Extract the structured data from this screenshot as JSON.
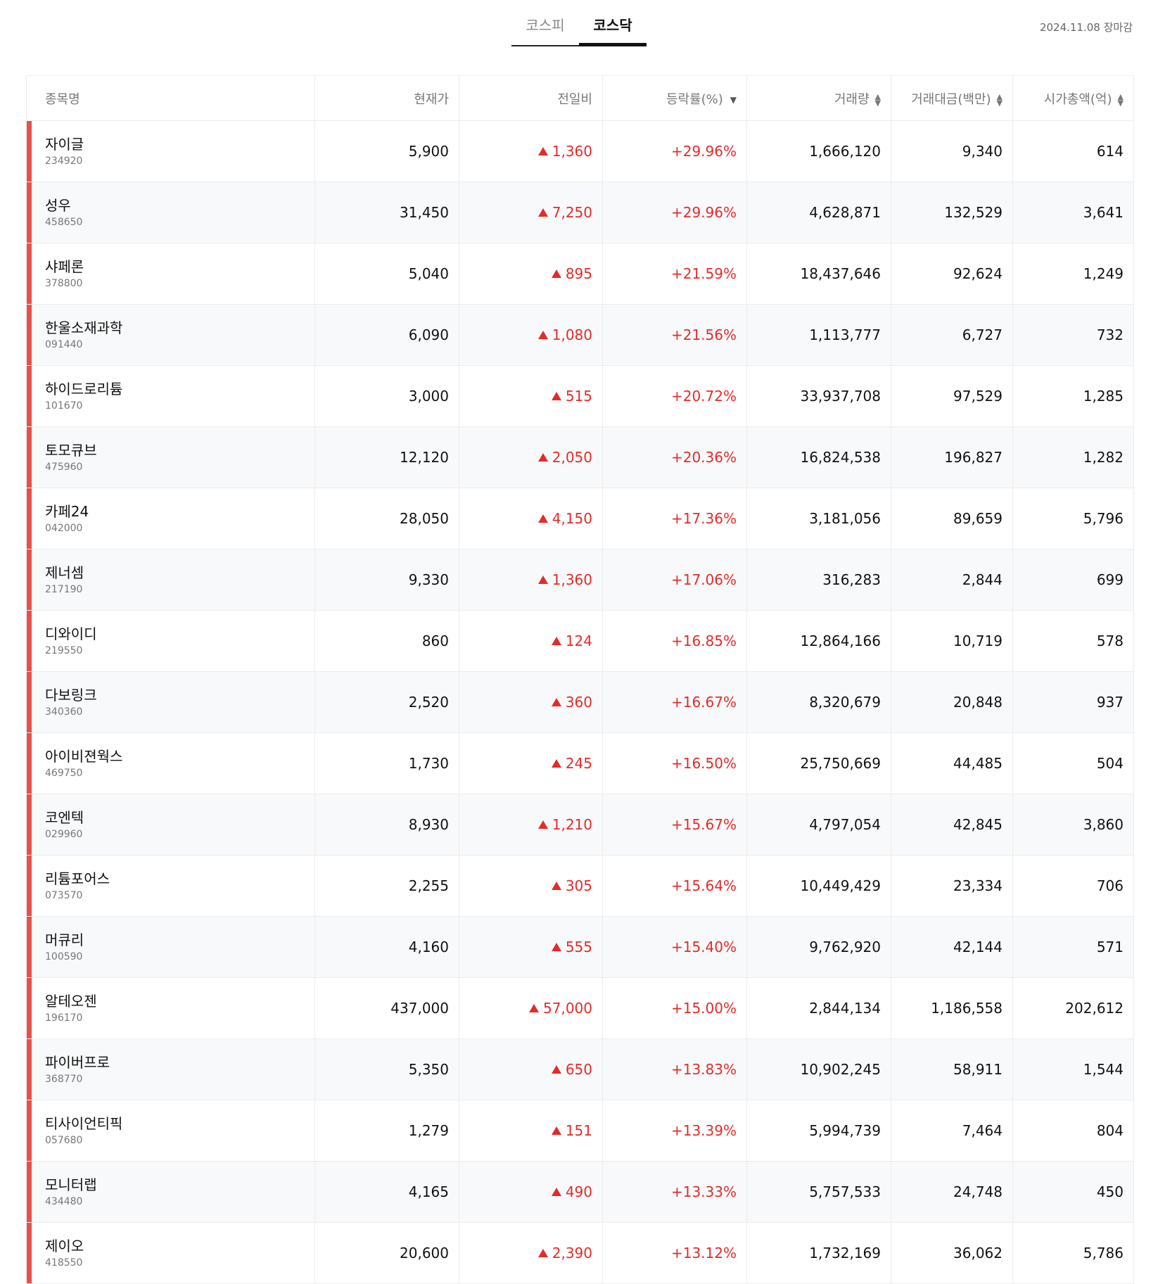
{
  "tabs": [
    {
      "label": "코스피",
      "active": false
    },
    {
      "label": "코스닥",
      "active": true
    }
  ],
  "date_label": "2024.11.08 장마감",
  "colors": {
    "up": "#e22c29",
    "row_bar": "#e8504a"
  },
  "columns": {
    "name": "종목명",
    "price": "현재가",
    "diff": "전일비",
    "rate": "등락률(%)",
    "volume": "거래량",
    "amount": "거래대금(백만)",
    "marketcap": "시가총액(억)"
  },
  "rows": [
    {
      "name": "자이글",
      "code": "234920",
      "price": "5,900",
      "diff": "1,360",
      "rate": "+29.96%",
      "volume": "1,666,120",
      "amount": "9,340",
      "marketcap": "614"
    },
    {
      "name": "성우",
      "code": "458650",
      "price": "31,450",
      "diff": "7,250",
      "rate": "+29.96%",
      "volume": "4,628,871",
      "amount": "132,529",
      "marketcap": "3,641"
    },
    {
      "name": "샤페론",
      "code": "378800",
      "price": "5,040",
      "diff": "895",
      "rate": "+21.59%",
      "volume": "18,437,646",
      "amount": "92,624",
      "marketcap": "1,249"
    },
    {
      "name": "한울소재과학",
      "code": "091440",
      "price": "6,090",
      "diff": "1,080",
      "rate": "+21.56%",
      "volume": "1,113,777",
      "amount": "6,727",
      "marketcap": "732"
    },
    {
      "name": "하이드로리튬",
      "code": "101670",
      "price": "3,000",
      "diff": "515",
      "rate": "+20.72%",
      "volume": "33,937,708",
      "amount": "97,529",
      "marketcap": "1,285"
    },
    {
      "name": "토모큐브",
      "code": "475960",
      "price": "12,120",
      "diff": "2,050",
      "rate": "+20.36%",
      "volume": "16,824,538",
      "amount": "196,827",
      "marketcap": "1,282"
    },
    {
      "name": "카페24",
      "code": "042000",
      "price": "28,050",
      "diff": "4,150",
      "rate": "+17.36%",
      "volume": "3,181,056",
      "amount": "89,659",
      "marketcap": "5,796"
    },
    {
      "name": "제너셈",
      "code": "217190",
      "price": "9,330",
      "diff": "1,360",
      "rate": "+17.06%",
      "volume": "316,283",
      "amount": "2,844",
      "marketcap": "699"
    },
    {
      "name": "디와이디",
      "code": "219550",
      "price": "860",
      "diff": "124",
      "rate": "+16.85%",
      "volume": "12,864,166",
      "amount": "10,719",
      "marketcap": "578"
    },
    {
      "name": "다보링크",
      "code": "340360",
      "price": "2,520",
      "diff": "360",
      "rate": "+16.67%",
      "volume": "8,320,679",
      "amount": "20,848",
      "marketcap": "937"
    },
    {
      "name": "아이비젼웍스",
      "code": "469750",
      "price": "1,730",
      "diff": "245",
      "rate": "+16.50%",
      "volume": "25,750,669",
      "amount": "44,485",
      "marketcap": "504"
    },
    {
      "name": "코엔텍",
      "code": "029960",
      "price": "8,930",
      "diff": "1,210",
      "rate": "+15.67%",
      "volume": "4,797,054",
      "amount": "42,845",
      "marketcap": "3,860"
    },
    {
      "name": "리튬포어스",
      "code": "073570",
      "price": "2,255",
      "diff": "305",
      "rate": "+15.64%",
      "volume": "10,449,429",
      "amount": "23,334",
      "marketcap": "706"
    },
    {
      "name": "머큐리",
      "code": "100590",
      "price": "4,160",
      "diff": "555",
      "rate": "+15.40%",
      "volume": "9,762,920",
      "amount": "42,144",
      "marketcap": "571"
    },
    {
      "name": "알테오젠",
      "code": "196170",
      "price": "437,000",
      "diff": "57,000",
      "rate": "+15.00%",
      "volume": "2,844,134",
      "amount": "1,186,558",
      "marketcap": "202,612"
    },
    {
      "name": "파이버프로",
      "code": "368770",
      "price": "5,350",
      "diff": "650",
      "rate": "+13.83%",
      "volume": "10,902,245",
      "amount": "58,911",
      "marketcap": "1,544"
    },
    {
      "name": "티사이언티픽",
      "code": "057680",
      "price": "1,279",
      "diff": "151",
      "rate": "+13.39%",
      "volume": "5,994,739",
      "amount": "7,464",
      "marketcap": "804"
    },
    {
      "name": "모니터랩",
      "code": "434480",
      "price": "4,165",
      "diff": "490",
      "rate": "+13.33%",
      "volume": "5,757,533",
      "amount": "24,748",
      "marketcap": "450"
    },
    {
      "name": "제이오",
      "code": "418550",
      "price": "20,600",
      "diff": "2,390",
      "rate": "+13.12%",
      "volume": "1,732,169",
      "amount": "36,062",
      "marketcap": "5,786"
    }
  ]
}
